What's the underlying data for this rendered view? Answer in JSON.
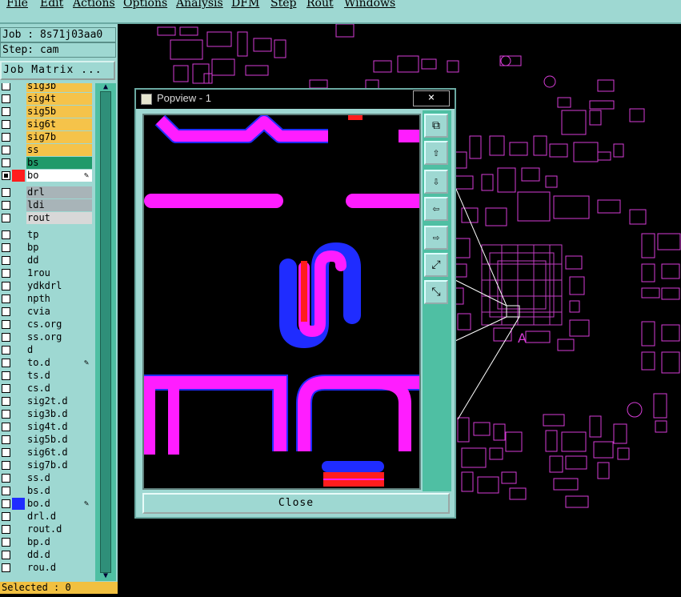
{
  "menu": {
    "file": "File",
    "edit": "Edit",
    "actions": "Actions",
    "options": "Options",
    "analysis": "Analysis",
    "dfm": "DFM",
    "step": "Step",
    "rout": "Rout",
    "windows": "Windows"
  },
  "job": {
    "job_line": "Job : 8s71j03aa0",
    "step_line": "Step: cam",
    "matrix_button": "Job Matrix ..."
  },
  "layers": [
    {
      "name": "sig3b",
      "color": "#f5c34a"
    },
    {
      "name": "sig4t",
      "color": "#f5c34a"
    },
    {
      "name": "sig5b",
      "color": "#f5c34a"
    },
    {
      "name": "sig6t",
      "color": "#f5c34a"
    },
    {
      "name": "sig7b",
      "color": "#f5c34a"
    },
    {
      "name": "ss",
      "color": "#f5c34a"
    },
    {
      "name": "bs",
      "color": "#1f9a6a"
    },
    {
      "name": "bo",
      "color": "#ffffff",
      "selected": true,
      "swatch": "#ff1d1d"
    },
    {
      "name": "drl",
      "color": "#a8b4b8"
    },
    {
      "name": "ldi",
      "color": "#a8b4b8"
    },
    {
      "name": "rout",
      "color": "#d8d8d8"
    },
    {
      "name": "tp",
      "color": "#9ed8d2"
    },
    {
      "name": "bp",
      "color": "#9ed8d2"
    },
    {
      "name": "dd",
      "color": "#9ed8d2"
    },
    {
      "name": "1rou",
      "color": "#9ed8d2"
    },
    {
      "name": "ydkdrl",
      "color": "#9ed8d2"
    },
    {
      "name": "npth",
      "color": "#9ed8d2"
    },
    {
      "name": "cvia",
      "color": "#9ed8d2"
    },
    {
      "name": "cs.org",
      "color": "#9ed8d2"
    },
    {
      "name": "ss.org",
      "color": "#9ed8d2"
    },
    {
      "name": "d",
      "color": "#9ed8d2"
    },
    {
      "name": "to.d",
      "color": "#9ed8d2",
      "edit": true
    },
    {
      "name": "ts.d",
      "color": "#9ed8d2"
    },
    {
      "name": "cs.d",
      "color": "#9ed8d2"
    },
    {
      "name": "sig2t.d",
      "color": "#9ed8d2"
    },
    {
      "name": "sig3b.d",
      "color": "#9ed8d2"
    },
    {
      "name": "sig4t.d",
      "color": "#9ed8d2"
    },
    {
      "name": "sig5b.d",
      "color": "#9ed8d2"
    },
    {
      "name": "sig6t.d",
      "color": "#9ed8d2"
    },
    {
      "name": "sig7b.d",
      "color": "#9ed8d2"
    },
    {
      "name": "ss.d",
      "color": "#9ed8d2"
    },
    {
      "name": "bs.d",
      "color": "#9ed8d2"
    },
    {
      "name": "bo.d",
      "color": "#9ed8d2",
      "edit": true,
      "swatch": "#1f2cff"
    },
    {
      "name": "drl.d",
      "color": "#9ed8d2"
    },
    {
      "name": "rout.d",
      "color": "#9ed8d2"
    },
    {
      "name": "bp.d",
      "color": "#9ed8d2"
    },
    {
      "name": "dd.d",
      "color": "#9ed8d2"
    },
    {
      "name": "rou.d",
      "color": "#9ed8d2"
    }
  ],
  "status": {
    "selected": "Selected : 0"
  },
  "popup": {
    "title": "Popview - 1",
    "close_x": "×",
    "close_button": "Close"
  },
  "board_marker": "A",
  "colors": {
    "panel": "#9ed8d2",
    "magenta": "#ff1dff",
    "blue": "#1f2cff",
    "red": "#ff1d1d",
    "accent": "#4fbfa3"
  }
}
